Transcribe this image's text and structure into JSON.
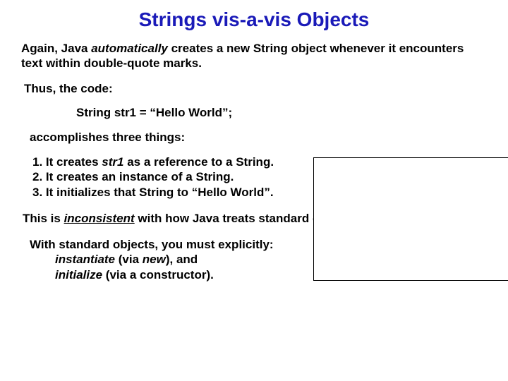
{
  "title": "Strings vis-a-vis Objects",
  "intro": {
    "pre": "Again, Java ",
    "em": "automatically",
    "post": " creates a new String object whenever it encounters text within double-quote marks."
  },
  "thus": "Thus, the code:",
  "code": "String str1 = “Hello World”;",
  "accomplishes": "accomplishes three things:",
  "list": {
    "n1": "1.  It creates ",
    "n1_em": "str1",
    "n1_post": " as a reference to a String.",
    "n2": "2.  It creates an instance of a String.",
    "n3": "3.  It initializes that String to “Hello World”."
  },
  "inconsistent": {
    "pre": "This is ",
    "em": "inconsistent",
    "post": " with how Java treats standard objects."
  },
  "standard": {
    "line1": "With standard objects, you must explicitly:",
    "a_em": "instantiate",
    "a_mid": " (via ",
    "a_new": "new",
    "a_post": "), and",
    "b_em": "initialize",
    "b_post": " (via a constructor)."
  }
}
